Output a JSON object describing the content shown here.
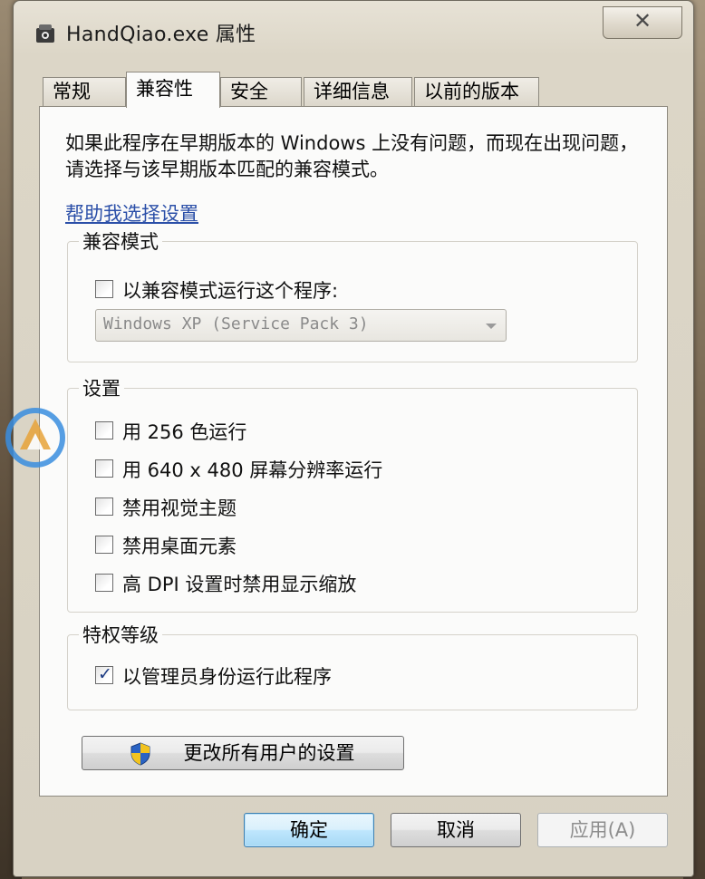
{
  "window": {
    "title": "HandQiao.exe 属性",
    "close_glyph": "✕"
  },
  "tabs": [
    {
      "label": "常规",
      "active": false
    },
    {
      "label": "兼容性",
      "active": true
    },
    {
      "label": "安全",
      "active": false
    },
    {
      "label": "详细信息",
      "active": false
    },
    {
      "label": "以前的版本",
      "active": false
    }
  ],
  "compat": {
    "description": "如果此程序在早期版本的 Windows 上没有问题，而现在出现问题，请选择与该早期版本匹配的兼容模式。",
    "help_link": "帮助我选择设置",
    "mode_group": {
      "title": "兼容模式",
      "checkbox_label": "以兼容模式运行这个程序:",
      "checked": false,
      "select_value": "Windows XP (Service Pack 3)"
    },
    "settings_group": {
      "title": "设置",
      "options": [
        {
          "label": "用 256 色运行",
          "checked": false
        },
        {
          "label": "用 640 x 480 屏幕分辨率运行",
          "checked": false
        },
        {
          "label": "禁用视觉主题",
          "checked": false
        },
        {
          "label": "禁用桌面元素",
          "checked": false
        },
        {
          "label": "高 DPI 设置时禁用显示缩放",
          "checked": false
        }
      ]
    },
    "privilege_group": {
      "title": "特权等级",
      "checkbox_label": "以管理员身份运行此程序",
      "checked": true
    },
    "change_all_users_button": "更改所有用户的设置",
    "check_glyph": "✓"
  },
  "footer": {
    "ok": "确定",
    "cancel": "取消",
    "apply": "应用(A)"
  },
  "colors": {
    "link": "#2b4fa8",
    "primary_button": "#bee6fd",
    "watermark": "#3a8ee0"
  },
  "icons": [
    "app-icon",
    "close-icon",
    "uac-shield-icon",
    "dropdown-arrow-icon",
    "checkmark-icon"
  ]
}
